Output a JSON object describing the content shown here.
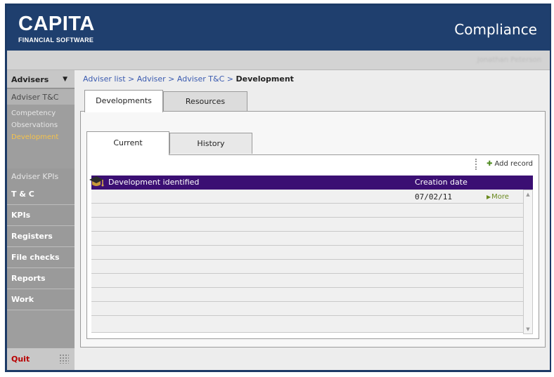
{
  "header": {
    "logo": "CAPITA",
    "logo_sub": "FINANCIAL SOFTWARE",
    "app_title": "Compliance"
  },
  "subbar": {
    "user": "Jonathan Peterson"
  },
  "sidebar": {
    "menu_label": "Advisers",
    "section1": "Adviser T&C",
    "sub_items": [
      {
        "label": "Competency"
      },
      {
        "label": "Observations"
      },
      {
        "label": "Development",
        "active": true
      }
    ],
    "section2": "Adviser KPIs",
    "items": [
      {
        "label": "T & C"
      },
      {
        "label": "KPIs"
      },
      {
        "label": "Registers"
      },
      {
        "label": "File checks"
      },
      {
        "label": "Reports"
      },
      {
        "label": "Work"
      }
    ],
    "quit": "Quit"
  },
  "breadcrumb": {
    "links": [
      "Adviser list",
      "Adviser",
      "Adviser T&C"
    ],
    "separator": " > ",
    "current": "Development"
  },
  "outer_tabs": [
    {
      "label": "Developments",
      "active": true
    },
    {
      "label": "Resources",
      "active": false
    }
  ],
  "inner_tabs": [
    {
      "label": "Current",
      "active": true
    },
    {
      "label": "History",
      "active": false
    }
  ],
  "actions": {
    "add_record": "Add record"
  },
  "table": {
    "columns": [
      "Development identified",
      "Creation date"
    ],
    "rows": [
      {
        "development": "",
        "creation_date": "07/02/11",
        "more": "More"
      }
    ],
    "empty_rows": 9
  },
  "colors": {
    "header_bg": "#1f3f6e",
    "table_header_bg": "#3b0f73",
    "active_sub_item": "#f5c24a",
    "quit_text": "#b80000",
    "link": "#3b5bb0",
    "add_icon": "#4d8a1e"
  },
  "icons": [
    "chevron-down-icon",
    "grip-icon",
    "plus-icon",
    "graduation-cap-icon",
    "arrow-right-icon",
    "scroll-up-icon",
    "scroll-down-icon"
  ]
}
